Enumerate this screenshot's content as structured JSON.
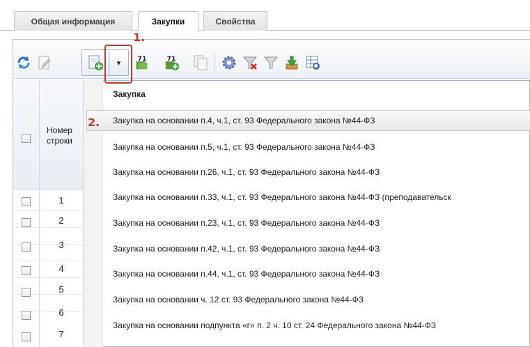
{
  "tabs": [
    {
      "label": "Общая информация",
      "active": false
    },
    {
      "label": "Закупки",
      "active": true
    },
    {
      "label": "Свойства",
      "active": false
    }
  ],
  "toolbar": {
    "icons": [
      "refresh-icon",
      "edit-doc-icon",
      "add-doc-icon",
      "dropdown-arrow-icon",
      "number-71-icon",
      "number-71-add-icon",
      "copy-doc-icon",
      "settings-gear-icon",
      "filter-clear-icon",
      "filter-icon",
      "download-icon",
      "table-preview-icon"
    ],
    "dropdown_arrow": "▾",
    "badge_71": "71"
  },
  "annotations": {
    "step1": "1.",
    "step2": "2.",
    "color": "#c0392b"
  },
  "grid": {
    "header_line1": "Номер",
    "header_line2": "строки",
    "row_numbers": [
      "1",
      "2",
      "3",
      "4",
      "5",
      "6",
      "7"
    ]
  },
  "menu": {
    "header": "Закупка",
    "items": [
      "Закупка на основании п.4, ч.1, ст. 93 Федерального закона №44-ФЗ",
      "Закупка на основании п.5, ч.1, ст. 93 Федерального закона №44-ФЗ",
      "Закупка на основании п.26, ч.1, ст. 93 Федерального закона №44-ФЗ",
      "Закупка на основании п.33, ч.1, ст. 93 Федерального закона №44-ФЗ (преподавательск",
      "Закупка на основании п.23, ч.1, ст. 93 Федерального закона №44-ФЗ",
      "Закупка на основании п.42, ч.1, ст. 93 Федерального закона №44-ФЗ",
      "Закупка на основании п.44, ч.1, ст. 93 Федерального закона №44-ФЗ",
      "Закупка на основании ч. 12 ст. 93 Федерального закона №44-ФЗ",
      "Закупка на основании подпункта «г» п. 2 ч. 10 ст. 24 Федерального закона №44-ФЗ"
    ]
  }
}
